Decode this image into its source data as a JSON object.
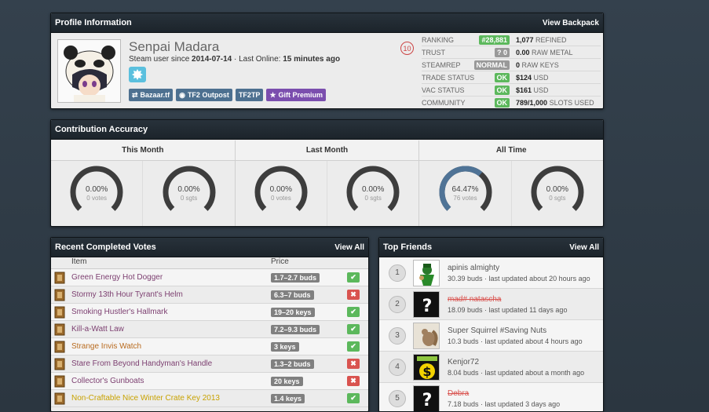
{
  "profile": {
    "header": "Profile Information",
    "view_backpack": "View Backpack",
    "name": "Senpai Madara",
    "since_prefix": "Steam user since",
    "since_date": "2014-07-14",
    "online_prefix": "· Last Online:",
    "online_value": "15 minutes ago",
    "level": "10",
    "links": [
      "Bazaar.tf",
      "TF2 Outpost",
      "TF2TP",
      "Gift Premium"
    ],
    "stats": [
      {
        "label": "Ranking",
        "tag": "#28,881",
        "tag_color": "#5cb85c",
        "value": "1,077",
        "unit": "Refined"
      },
      {
        "label": "Trust",
        "tag": "? 0",
        "tag_color": "#999999",
        "value": "0.00",
        "unit": "Raw Metal"
      },
      {
        "label": "SteamRep",
        "tag": "NORMAL",
        "tag_color": "#999999",
        "value": "0",
        "unit": "Raw Keys"
      },
      {
        "label": "Trade Status",
        "tag": "OK",
        "tag_color": "#5cb85c",
        "value": "$124",
        "unit": "USD"
      },
      {
        "label": "VAC Status",
        "tag": "OK",
        "tag_color": "#5cb85c",
        "value": "$161",
        "unit": "USD"
      },
      {
        "label": "Community",
        "tag": "OK",
        "tag_color": "#5cb85c",
        "value": "789/1,000",
        "unit": "Slots Used"
      }
    ]
  },
  "contribution": {
    "header": "Contribution Accuracy",
    "columns": [
      {
        "title": "This Month",
        "gauges": [
          {
            "pct": "0.00%",
            "sub": "0 votes",
            "fill": 0
          },
          {
            "pct": "0.00%",
            "sub": "0 sgts",
            "fill": 0
          }
        ]
      },
      {
        "title": "Last Month",
        "gauges": [
          {
            "pct": "0.00%",
            "sub": "0 votes",
            "fill": 0
          },
          {
            "pct": "0.00%",
            "sub": "0 sgts",
            "fill": 0
          }
        ]
      },
      {
        "title": "All Time",
        "gauges": [
          {
            "pct": "64.47%",
            "sub": "76 votes",
            "fill": 0.6447
          },
          {
            "pct": "0.00%",
            "sub": "0 sgts",
            "fill": 0
          }
        ]
      }
    ]
  },
  "votes": {
    "header": "Recent Completed Votes",
    "view_all": "View All",
    "col_item": "Item",
    "col_price": "Price",
    "rows": [
      {
        "item": "Green Energy Hot Dogger",
        "color": "#7d4071",
        "price": "1.7–2.7 buds",
        "vote": "up"
      },
      {
        "item": "Stormy 13th Hour Tyrant's Helm",
        "color": "#7d4071",
        "price": "6.3–7 buds",
        "vote": "down"
      },
      {
        "item": "Smoking Hustler's Hallmark",
        "color": "#7d4071",
        "price": "19–20 keys",
        "vote": "up"
      },
      {
        "item": "Kill-a-Watt Law",
        "color": "#7d4071",
        "price": "7.2–9.3 buds",
        "vote": "up"
      },
      {
        "item": "Strange Invis Watch",
        "color": "#b86b1f",
        "price": "3 keys",
        "vote": "up"
      },
      {
        "item": "Stare From Beyond Handyman's Handle",
        "color": "#7d4071",
        "price": "1.3–2 buds",
        "vote": "down"
      },
      {
        "item": "Collector's Gunboats",
        "color": "#7d4071",
        "price": "20 keys",
        "vote": "down"
      },
      {
        "item": "Non-Craftable Nice Winter Crate Key 2013",
        "color": "#c8a200",
        "price": "1.4 keys",
        "vote": "up"
      }
    ]
  },
  "friends": {
    "header": "Top Friends",
    "view_all": "View All",
    "rows": [
      {
        "rank": "1",
        "name": "apinis almighty",
        "info": "30.39 buds · last updated about 20 hours ago",
        "struck": false,
        "avatar": "leprechaun"
      },
      {
        "rank": "2",
        "name": "mad# natascha",
        "info": "18.09 buds · last updated 11 days ago",
        "struck": true,
        "avatar": "question"
      },
      {
        "rank": "3",
        "name": "Super Squirrel #Saving Nuts",
        "info": "10.3 buds · last updated about 4 hours ago",
        "struck": false,
        "avatar": "squirrel"
      },
      {
        "rank": "4",
        "name": "Kenjor72",
        "info": "8.04 buds · last updated about a month ago",
        "struck": false,
        "avatar": "dollar"
      },
      {
        "rank": "5",
        "name": "Debra",
        "info": "7.18 buds · last updated 3 days ago",
        "struck": true,
        "avatar": "question"
      }
    ]
  }
}
